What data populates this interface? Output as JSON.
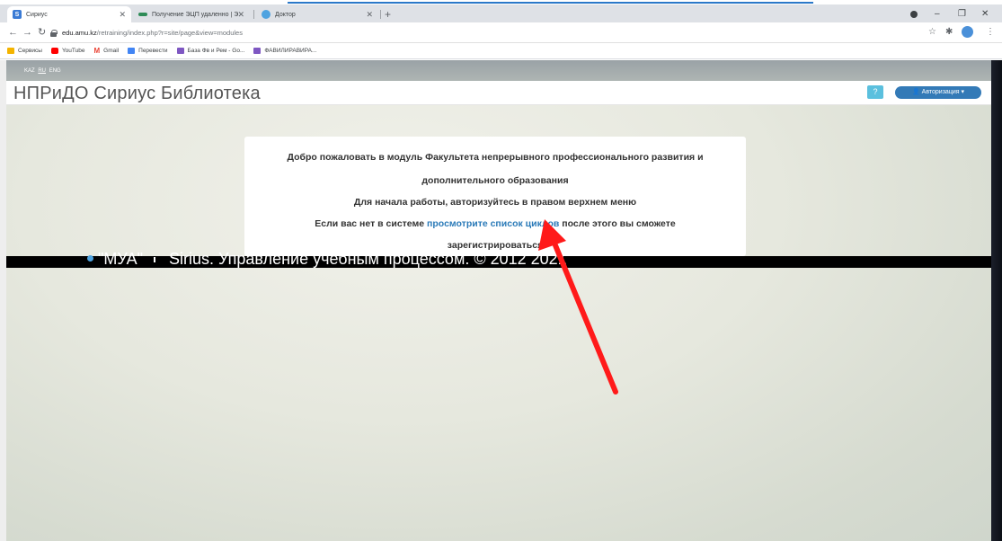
{
  "browser": {
    "tabs": [
      {
        "title": "Сириус",
        "favicon": "S",
        "favicon_color": "#3a7bd5"
      },
      {
        "title": "Получение ЭЦП удаленно | Эл",
        "favicon": "",
        "favicon_color": "#2e8b57"
      },
      {
        "title": "Доктор",
        "favicon": "",
        "favicon_color": "#4fa3e0"
      }
    ],
    "new_tab": "+",
    "url_host": "edu.amu.kz",
    "url_path": "/retraining/index.php?r=site/page&view=modules",
    "bookmarks": [
      {
        "label": "Сервисы",
        "icon_color": "#f4b400"
      },
      {
        "label": "YouTube",
        "icon_color": "#ff0000"
      },
      {
        "label": "Gmail",
        "icon_color": "#ea4335"
      },
      {
        "label": "Перевести",
        "icon_color": "#4285f4"
      },
      {
        "label": "База Фв и Рем - Go...",
        "icon_color": "#7e57c2"
      },
      {
        "label": "ФАВИЛИРАВИРА...",
        "icon_color": "#7e57c2"
      }
    ]
  },
  "page": {
    "languages": [
      "KAZ",
      "RU",
      "ENG"
    ],
    "title": "НПРиДО Сириус Библиотека",
    "help_label": "?",
    "auth_label": "Авторизация",
    "welcome": {
      "line1": "Добро пожаловать в модуль Факультета непрерывного профессионального развития и",
      "line2": "дополнительного образования",
      "line3": "Для начала работы, авторизуйтесь в правом верхнем меню",
      "line4_pre": "Если вас нет в системе ",
      "line4_link": "просмотрите список циклов",
      "line4_post": " после этого вы сможете",
      "line5": "зарегистрироваться"
    },
    "footer": {
      "org": "\"МУА\"",
      "text": "Sirius. Управление учебным процессом. © 2012 2021"
    }
  },
  "colors": {
    "accent_link": "#2a7ab8",
    "auth_button": "#337ab7",
    "help_button": "#5bc0de",
    "arrow": "#ff1a1a"
  }
}
